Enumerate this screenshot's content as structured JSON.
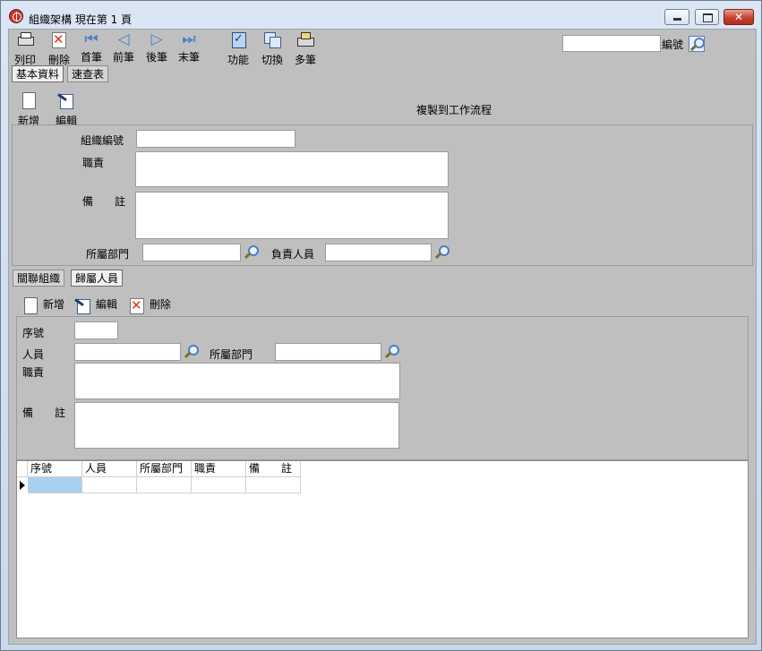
{
  "window": {
    "title": "組織架構 現在第 1 頁",
    "min_glyph": "minimize-glyph",
    "close_glyph": "✕"
  },
  "toolbar": {
    "print": "列印",
    "delete": "刪除",
    "first": "首筆",
    "prev": "前筆",
    "next": "後筆",
    "last": "末筆",
    "function": "功能",
    "switch": "切換",
    "multi": "多筆",
    "search_label": "編號",
    "search_value": ""
  },
  "main_tabs": [
    "基本資料",
    "速查表"
  ],
  "record_toolbar": {
    "new": "新增",
    "edit": "編輯",
    "copy_to_workflow": "複製到工作流程"
  },
  "form": {
    "org_code_label": "組織編號",
    "org_code_value": "",
    "duties_label": "職責",
    "duties_value": "",
    "notes_label": "備　　註",
    "notes_value": "",
    "dept_label": "所屬部門",
    "dept_value": "",
    "manager_label": "負責人員",
    "manager_value": ""
  },
  "sub_tabs": [
    "關聯組織",
    "歸屬人員"
  ],
  "sub_toolbar": {
    "new": "新增",
    "edit": "編輯",
    "delete": "刪除"
  },
  "sub_form": {
    "seq_label": "序號",
    "seq_value": "",
    "person_label": "人員",
    "person_value": "",
    "dept_label": "所屬部門",
    "dept_value": "",
    "duties_label": "職責",
    "duties_value": "",
    "notes_label": "備　　註",
    "notes_value": ""
  },
  "grid": {
    "columns": [
      "序號",
      "人員",
      "所屬部門",
      "職責",
      "備　　註"
    ],
    "rows": [
      [
        "",
        "",
        "",
        "",
        ""
      ]
    ]
  },
  "colors": {
    "selected_cell": "#a8d0f0"
  }
}
